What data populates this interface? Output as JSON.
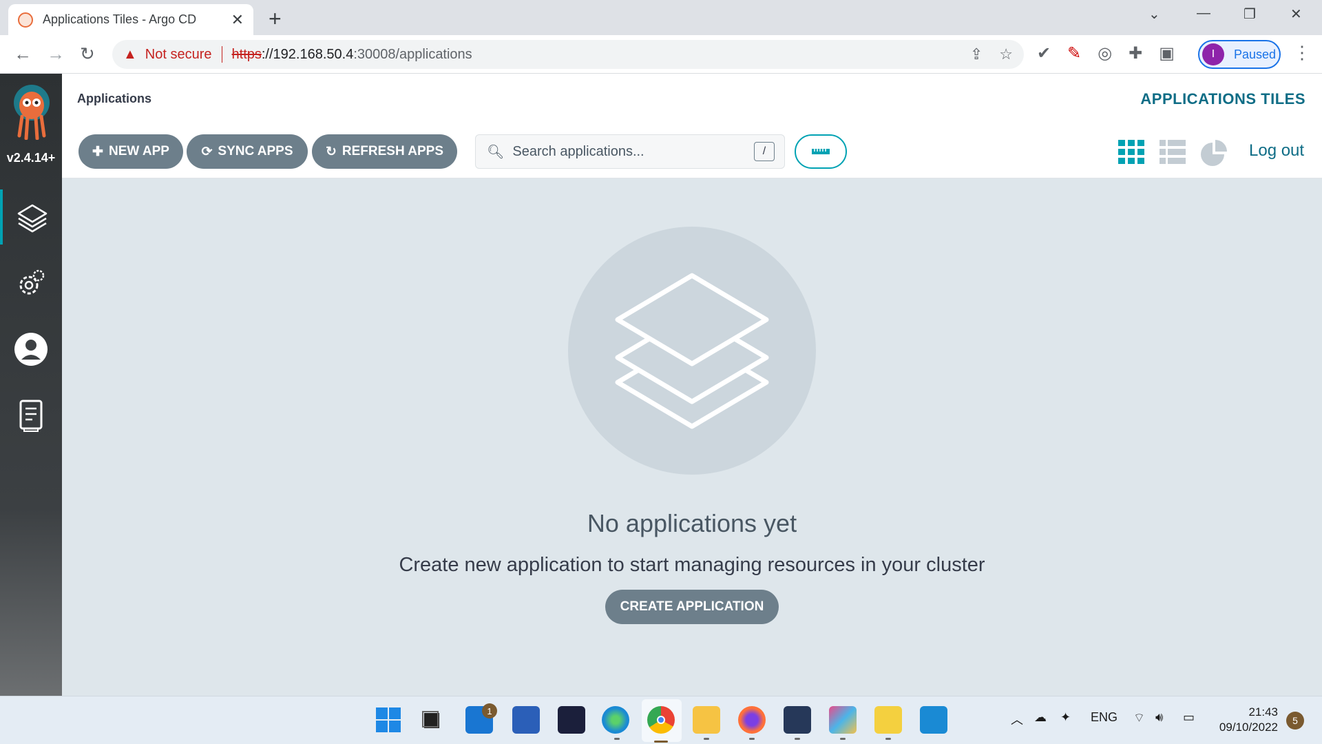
{
  "browser": {
    "tab_title": "Applications Tiles - Argo CD",
    "new_tab": "+",
    "security_label": "Not secure",
    "url_protocol": "https",
    "url_host": "://192.168.50.4",
    "url_path": ":30008/applications",
    "profile_initial": "I",
    "profile_status": "Paused"
  },
  "sidebar": {
    "version": "v2.4.14+",
    "items": [
      "applications",
      "settings",
      "user-info",
      "documentation"
    ]
  },
  "header": {
    "title": "Applications",
    "view_title": "APPLICATIONS TILES"
  },
  "toolbar": {
    "new_app": "NEW APP",
    "sync_apps": "SYNC APPS",
    "refresh_apps": "REFRESH APPS",
    "search_placeholder": "Search applications...",
    "search_shortcut": "/",
    "logout": "Log out"
  },
  "empty_state": {
    "title": "No applications yet",
    "description": "Create new application to start managing resources in your cluster",
    "create_button": "CREATE APPLICATION"
  },
  "taskbar": {
    "mail_badge": "1",
    "language": "ENG",
    "time": "21:43",
    "date": "09/10/2022",
    "notifications": "5"
  },
  "colors": {
    "accent": "#00a2b3",
    "button": "#6d7f8b",
    "link": "#0f6d86",
    "content_bg": "#dee6eb"
  }
}
